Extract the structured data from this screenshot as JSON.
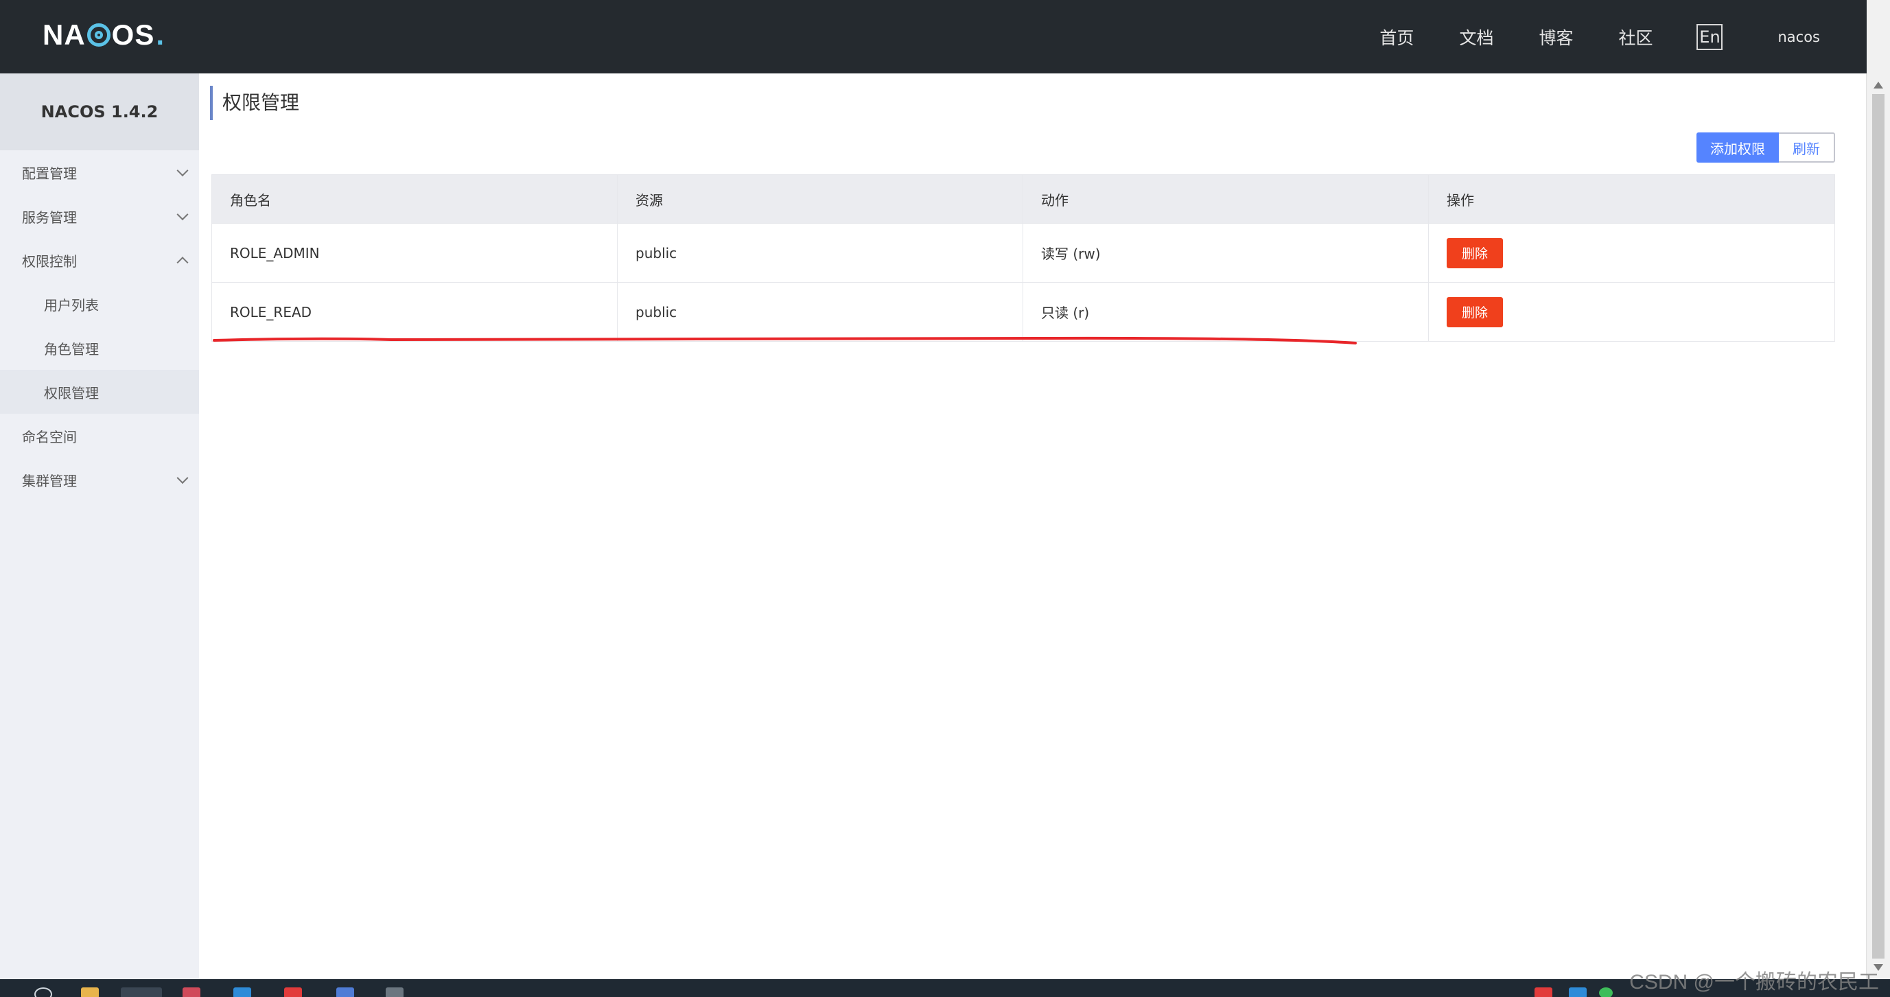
{
  "header": {
    "logo": "NACOS",
    "nav": [
      "首页",
      "文档",
      "博客",
      "社区"
    ],
    "lang": "En",
    "user": "nacos"
  },
  "sidebar": {
    "version": "NACOS 1.4.2",
    "items": [
      {
        "label": "配置管理",
        "chevron": "down"
      },
      {
        "label": "服务管理",
        "chevron": "down"
      },
      {
        "label": "权限控制",
        "chevron": "up"
      },
      {
        "label": "用户列表",
        "sub": true
      },
      {
        "label": "角色管理",
        "sub": true
      },
      {
        "label": "权限管理",
        "sub": true,
        "active": true
      },
      {
        "label": "命名空间"
      },
      {
        "label": "集群管理",
        "chevron": "down"
      }
    ]
  },
  "main": {
    "title": "权限管理",
    "add_button": "添加权限",
    "refresh_button": "刷新",
    "table": {
      "headers": [
        "角色名",
        "资源",
        "动作",
        "操作"
      ],
      "rows": [
        {
          "role": "ROLE_ADMIN",
          "resource": "public",
          "action": "读写 (rw)",
          "op": "删除"
        },
        {
          "role": "ROLE_READ",
          "resource": "public",
          "action": "只读 (r)",
          "op": "删除"
        }
      ]
    }
  },
  "watermark": "CSDN @一个搬砖的农民工",
  "colors": {
    "header_bg": "#252a2f",
    "primary": "#5584ff",
    "danger": "#f0401c",
    "annotation": "#e8262a"
  }
}
